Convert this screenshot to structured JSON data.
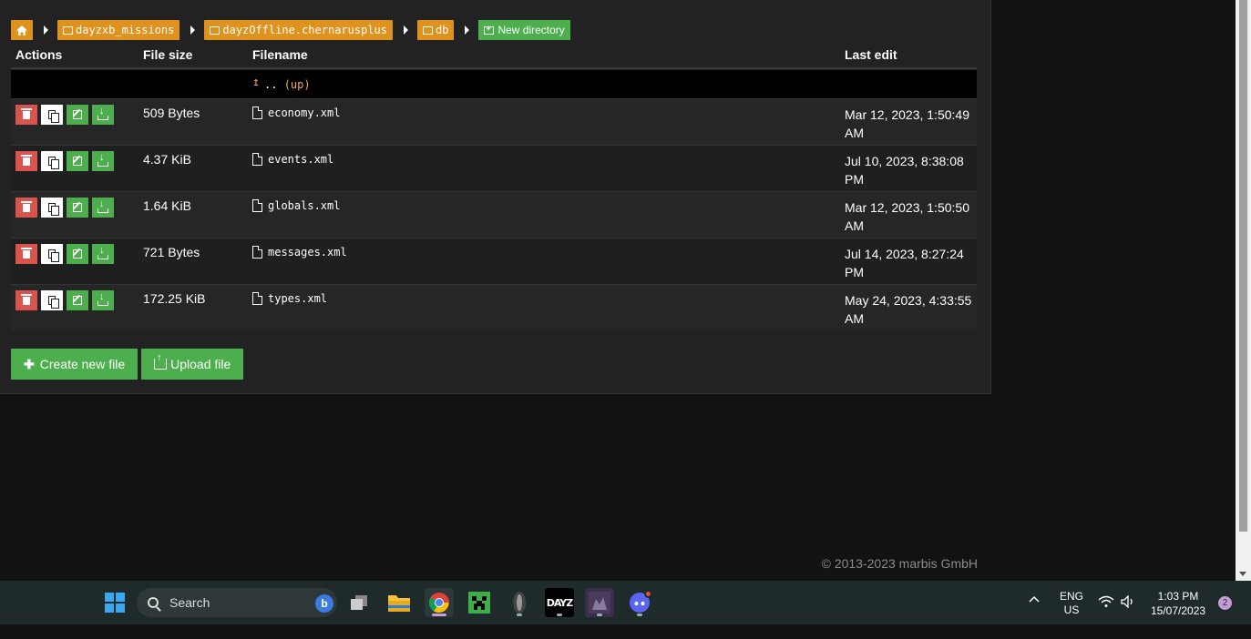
{
  "breadcrumb": {
    "items": [
      "dayzxb_missions",
      "dayzOffline.chernarusplus",
      "db"
    ],
    "new_directory": "New directory"
  },
  "table": {
    "headers": {
      "actions": "Actions",
      "size": "File size",
      "name": "Filename",
      "edit": "Last edit"
    },
    "up_row": {
      "dots": "..",
      "label": "(up)"
    },
    "rows": [
      {
        "size": "509 Bytes",
        "name": "economy.xml",
        "edit": "Mar 12, 2023, 1:50:49 AM"
      },
      {
        "size": "4.37 KiB",
        "name": "events.xml",
        "edit": "Jul 10, 2023, 8:38:08 PM"
      },
      {
        "size": "1.64 KiB",
        "name": "globals.xml",
        "edit": "Mar 12, 2023, 1:50:50 AM"
      },
      {
        "size": "721 Bytes",
        "name": "messages.xml",
        "edit": "Jul 14, 2023, 8:27:24 PM"
      },
      {
        "size": "172.25 KiB",
        "name": "types.xml",
        "edit": "May 24, 2023, 4:33:55 AM"
      }
    ]
  },
  "buttons": {
    "create": "Create new file",
    "upload": "Upload file"
  },
  "footer": "© 2013-2023 marbis GmbH",
  "taskbar": {
    "search_placeholder": "Search",
    "lang": [
      "ENG",
      "US"
    ],
    "time": "1:03 PM",
    "date": "15/07/2023",
    "notifications": "2",
    "dayz_label": "DAYZ"
  },
  "colors": {
    "accent_orange": "#e0921f",
    "green": "#4cae4c",
    "red": "#d9534f"
  }
}
